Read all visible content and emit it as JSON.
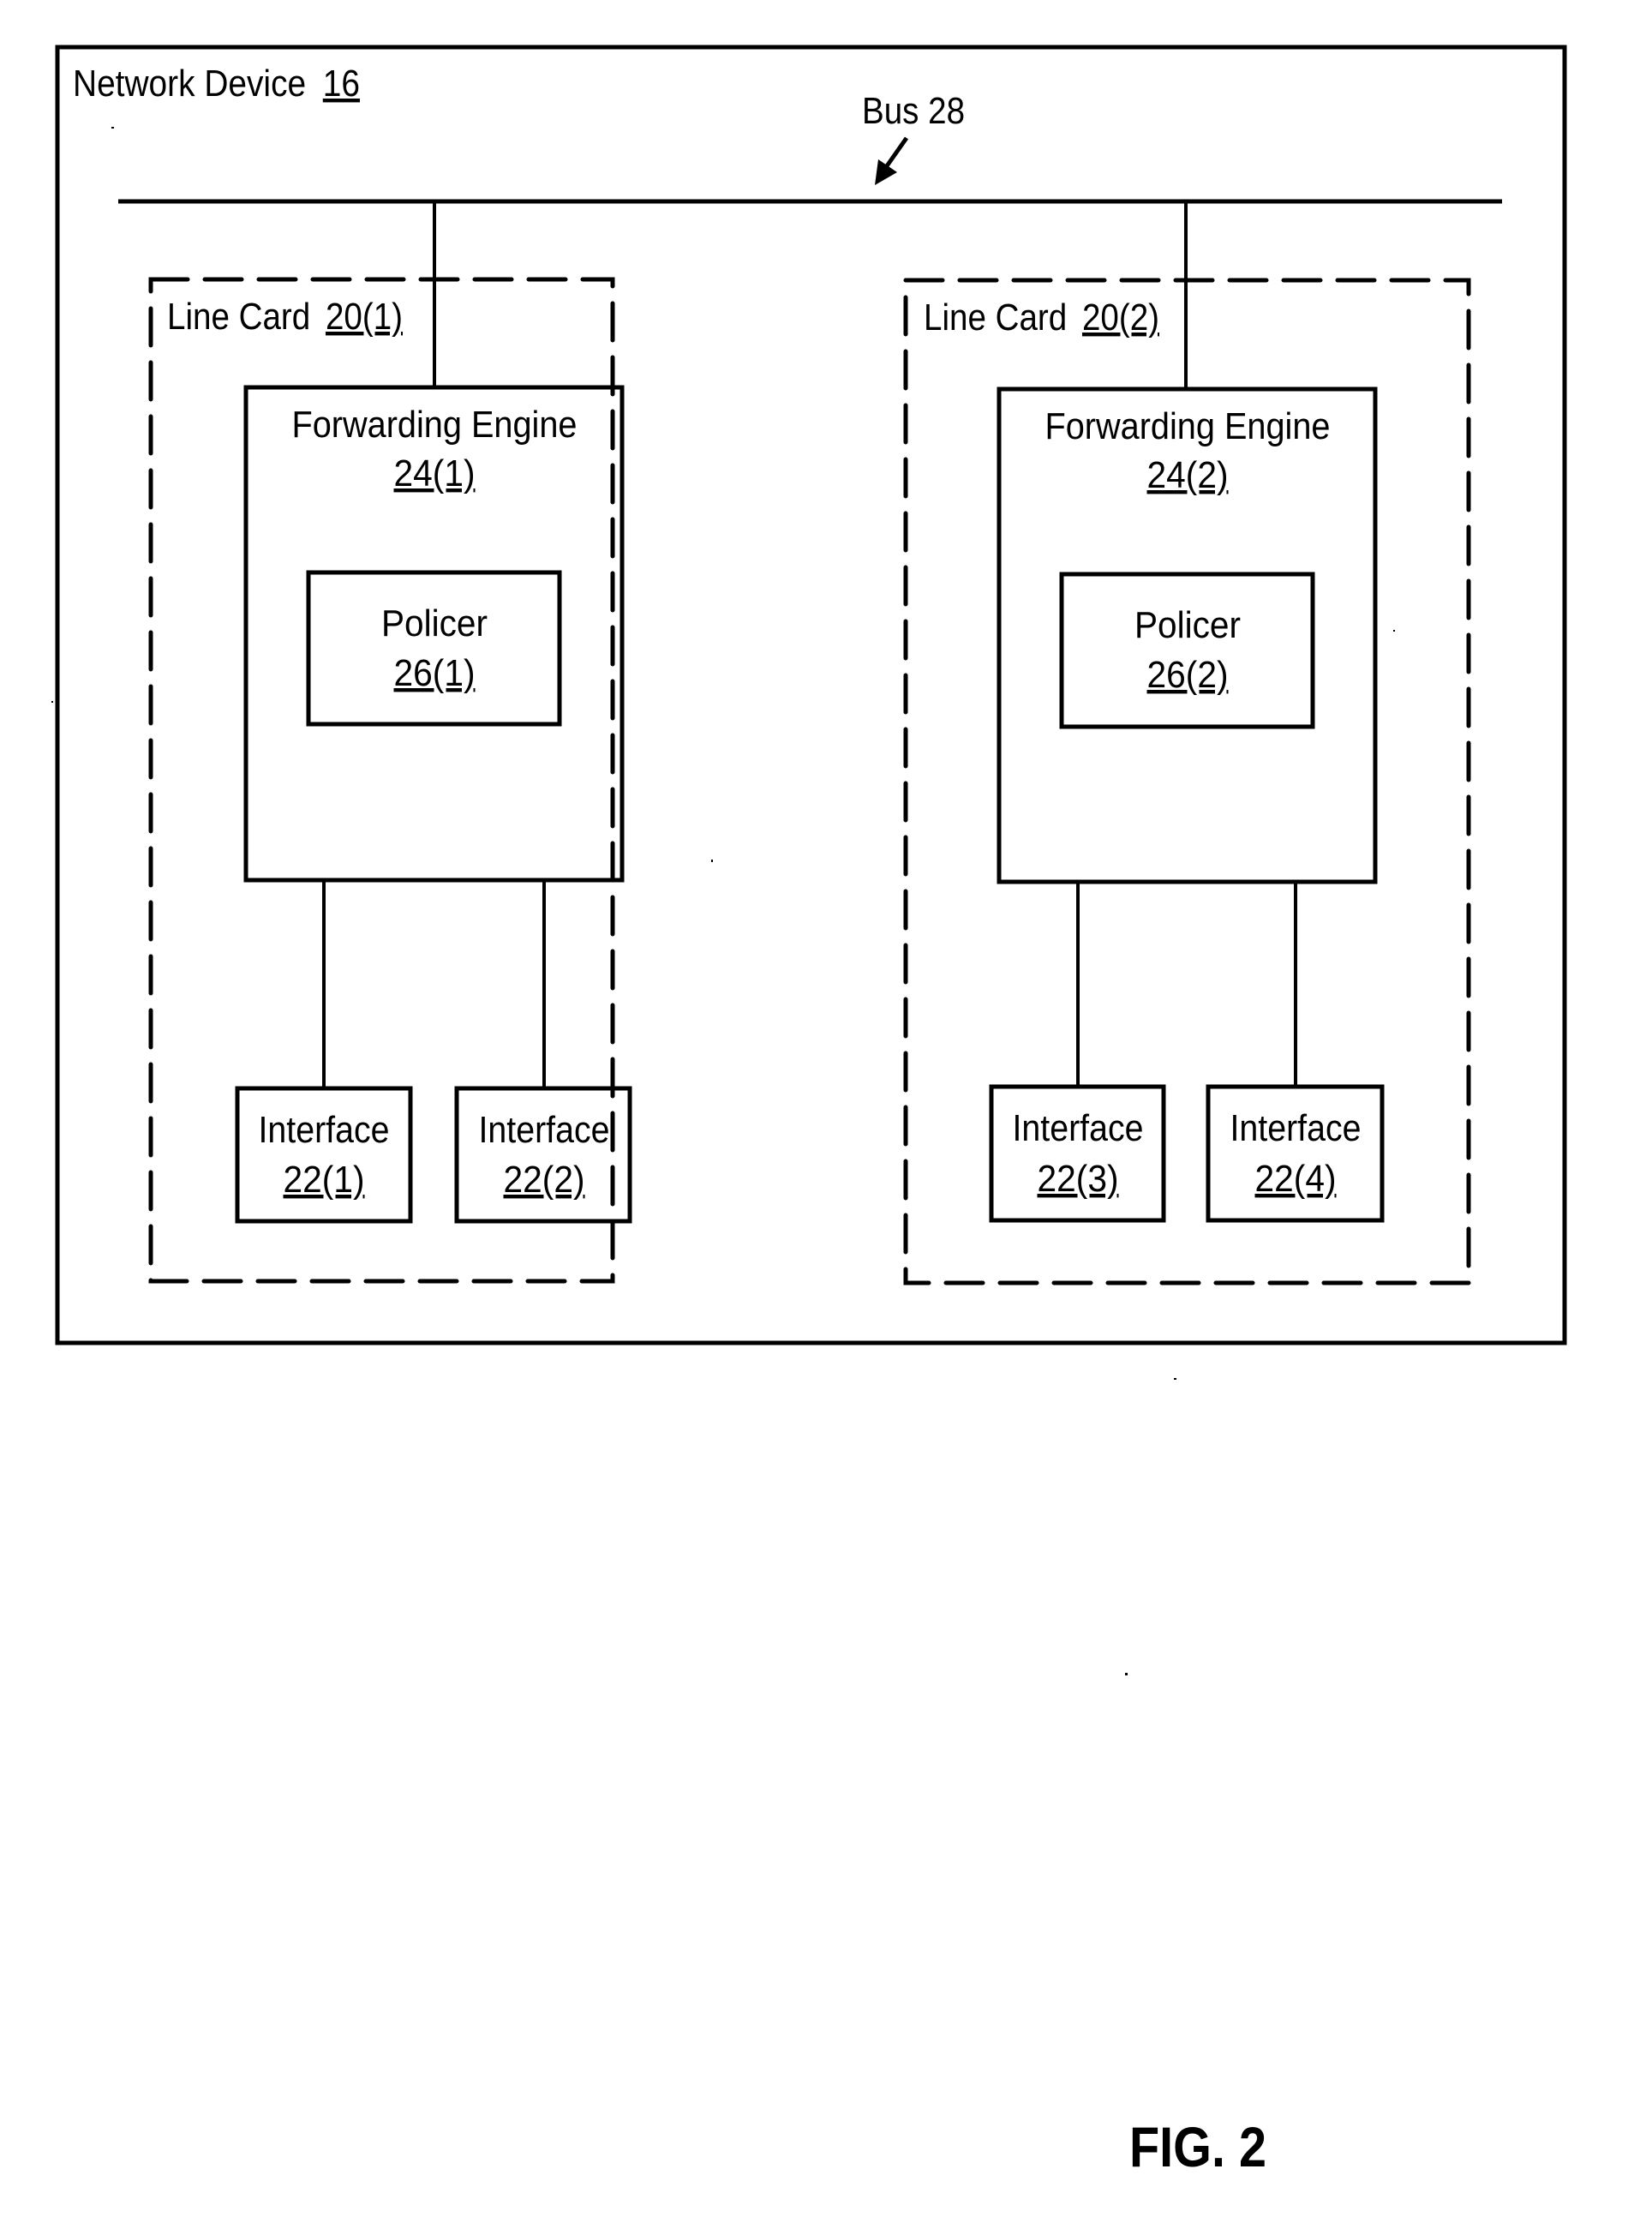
{
  "figure": {
    "caption": "FIG. 2",
    "ink_color": "#000000",
    "background_color": "#ffffff"
  },
  "network_device": {
    "label": "Network Device",
    "ref": "16"
  },
  "bus": {
    "label": "Bus 28"
  },
  "line_cards": [
    {
      "label": "Line Card",
      "ref": "20(1)",
      "forwarding_engine": {
        "label": "Forwarding Engine",
        "ref": "24(1)"
      },
      "policer": {
        "label": "Policer",
        "ref": "26(1)"
      },
      "interfaces": [
        {
          "label": "Interface",
          "ref": "22(1)"
        },
        {
          "label": "Interface",
          "ref": "22(2)"
        }
      ]
    },
    {
      "label": "Line Card",
      "ref": "20(2)",
      "forwarding_engine": {
        "label": "Forwarding Engine",
        "ref": "24(2)"
      },
      "policer": {
        "label": "Policer",
        "ref": "26(2)"
      },
      "interfaces": [
        {
          "label": "Interface",
          "ref": "22(3)"
        },
        {
          "label": "Interface",
          "ref": "22(4)"
        }
      ]
    }
  ]
}
